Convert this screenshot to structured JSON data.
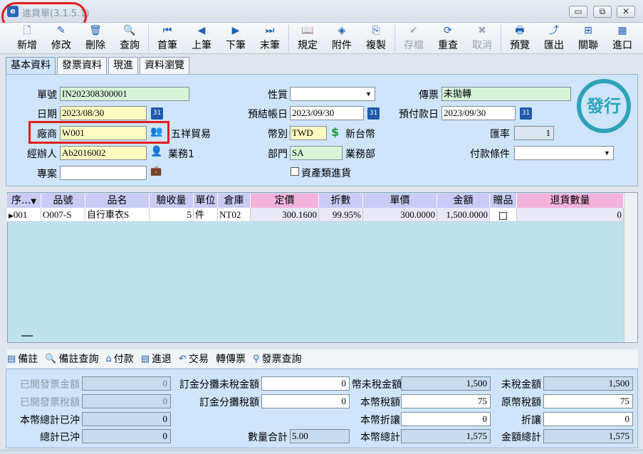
{
  "window": {
    "title": "進貨單(3.1.5.1)",
    "logo": "e",
    "minimize_label": "▭",
    "restore_label": "⧉",
    "close_label": "✕"
  },
  "toolbar": [
    {
      "id": "new",
      "label": "新增",
      "icon": "new-doc-icon",
      "glyph": "🗋",
      "enabled": true
    },
    {
      "id": "edit",
      "label": "修改",
      "icon": "edit-icon",
      "glyph": "✎",
      "enabled": true
    },
    {
      "id": "delete",
      "label": "刪除",
      "icon": "trash-icon",
      "glyph": "🗑",
      "enabled": true
    },
    {
      "id": "query",
      "label": "查詢",
      "icon": "search-icon",
      "glyph": "🔍",
      "enabled": true
    },
    {
      "id": "first",
      "label": "首筆",
      "icon": "first-record-icon",
      "glyph": "⏮",
      "enabled": true
    },
    {
      "id": "prev",
      "label": "上筆",
      "icon": "prev-record-icon",
      "glyph": "◀",
      "enabled": true
    },
    {
      "id": "next",
      "label": "下筆",
      "icon": "next-record-icon",
      "glyph": "▶",
      "enabled": true
    },
    {
      "id": "last",
      "label": "末筆",
      "icon": "last-record-icon",
      "glyph": "⏭",
      "enabled": true
    },
    {
      "id": "spec",
      "label": "規定",
      "icon": "book-icon",
      "glyph": "📖",
      "enabled": true
    },
    {
      "id": "attach",
      "label": "附件",
      "icon": "attachment-icon",
      "glyph": "◈",
      "enabled": true
    },
    {
      "id": "copy",
      "label": "複製",
      "icon": "copy-icon",
      "glyph": "⎘",
      "enabled": true
    },
    {
      "id": "save",
      "label": "存檔",
      "icon": "save-check-icon",
      "glyph": "✔",
      "enabled": false
    },
    {
      "id": "reset",
      "label": "重查",
      "icon": "refresh-icon",
      "glyph": "⟳",
      "enabled": true
    },
    {
      "id": "cancel",
      "label": "取消",
      "icon": "cancel-icon",
      "glyph": "✖",
      "enabled": false
    },
    {
      "id": "preview",
      "label": "預覽",
      "icon": "printer-icon",
      "glyph": "🖶",
      "enabled": true
    },
    {
      "id": "export",
      "label": "匯出",
      "icon": "export-icon",
      "glyph": "⤴",
      "enabled": true
    },
    {
      "id": "link",
      "label": "關聯",
      "icon": "link-tree-icon",
      "glyph": "⊞",
      "enabled": true
    },
    {
      "id": "import",
      "label": "進口",
      "icon": "import-icon",
      "glyph": "▦",
      "enabled": true
    }
  ],
  "tabs": [
    "基本資料",
    "發票資料",
    "現進",
    "資料瀏覽"
  ],
  "header": {
    "doc_no": {
      "label": "單號",
      "value": "IN202308300001"
    },
    "date": {
      "label": "日期",
      "value": "2023/08/30"
    },
    "vendor": {
      "label": "廠商",
      "value": "W001",
      "name": "五祥貿易"
    },
    "handler": {
      "label": "經辦人",
      "value": "Ab2016002",
      "name": "業務1"
    },
    "project": {
      "label": "專案",
      "value": ""
    },
    "nature": {
      "label": "性質",
      "value": ""
    },
    "settle_date": {
      "label": "預結帳日",
      "value": "2023/09/30"
    },
    "currency": {
      "label": "幣別",
      "value": "TWD",
      "name": "新台幣"
    },
    "dept": {
      "label": "部門",
      "value": "SA",
      "name": "業務部"
    },
    "asset_purchase": {
      "label": "資產類進貨",
      "checked": false
    },
    "voucher": {
      "label": "傳票",
      "value": "未拋轉"
    },
    "pay_date": {
      "label": "預付款日",
      "value": "2023/09/30"
    },
    "rate": {
      "label": "匯率",
      "value": "1"
    },
    "pay_terms": {
      "label": "付款條件",
      "value": ""
    },
    "stamp": "發行"
  },
  "grid": {
    "columns": [
      "序...",
      "品號",
      "品名",
      "驗收量",
      "單位",
      "倉庫",
      "定價",
      "折數",
      "單價",
      "金額",
      "贈品",
      "退貨數量"
    ],
    "rows": [
      {
        "seq": "001",
        "item_no": "O007-S",
        "item_name": "自行車衣S",
        "qty": "5",
        "unit": "件",
        "warehouse": "NT02",
        "list_price": "300.1600",
        "discount": "99.95%",
        "unit_price": "300.0000",
        "amount": "1,500.0000",
        "gift": false,
        "return_qty": "0"
      }
    ]
  },
  "bottom_tools": [
    {
      "label": "備註",
      "icon": "note-icon",
      "glyph": "▤"
    },
    {
      "label": "備註查詢",
      "icon": "search-icon",
      "glyph": "🔍"
    },
    {
      "label": "付款",
      "icon": "payment-icon",
      "glyph": "⌂"
    },
    {
      "label": "進退",
      "icon": "return-icon",
      "glyph": "▤"
    },
    {
      "label": "交易",
      "icon": "undo-icon",
      "glyph": "↶"
    },
    {
      "label": "轉傳票",
      "icon": "",
      "glyph": ""
    },
    {
      "label": "發票查詢",
      "icon": "invoice-search-icon",
      "glyph": "⚲"
    }
  ],
  "summary": {
    "invoiced_amount": {
      "label": "已開發票金額",
      "value": "0"
    },
    "invoiced_tax": {
      "label": "已開發票稅額",
      "value": "0"
    },
    "local_offset": {
      "label": "本幣總計已沖",
      "value": "0"
    },
    "total_offset": {
      "label": "總計已沖",
      "value": "0"
    },
    "deposit_untaxed": {
      "label": "訂金分攤未稅金額",
      "value": "0"
    },
    "deposit_tax": {
      "label": "訂金分攤稅額",
      "value": "0"
    },
    "qty_total": {
      "label": "數量合計",
      "value": "5.00"
    },
    "local_untaxed": {
      "label": "幣未稅金額",
      "value": "1,500"
    },
    "local_tax": {
      "label": "本幣稅額",
      "value": "75"
    },
    "local_discount": {
      "label": "本幣折讓",
      "value": "0"
    },
    "local_total": {
      "label": "本幣總計",
      "value": "1,575"
    },
    "untaxed": {
      "label": "未稅金額",
      "value": "1,500"
    },
    "orig_tax": {
      "label": "原幣稅額",
      "value": "75"
    },
    "discount": {
      "label": "折讓",
      "value": "0"
    },
    "amount_total": {
      "label": "金額總計",
      "value": "1,575"
    }
  }
}
